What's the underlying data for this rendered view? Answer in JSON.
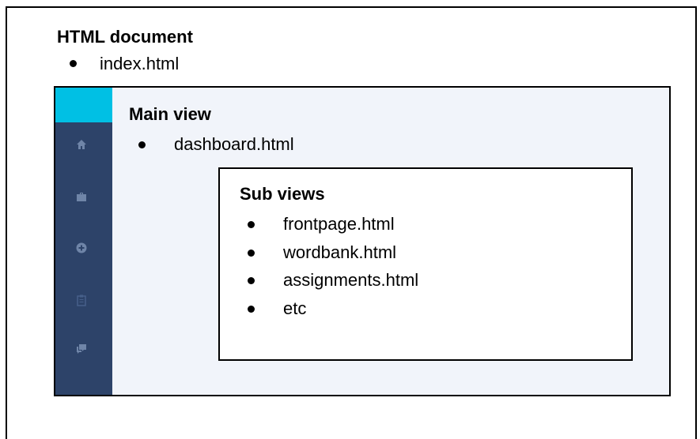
{
  "html_document": {
    "title": "HTML document",
    "files": [
      "index.html"
    ]
  },
  "main_view": {
    "title": "Main view",
    "files": [
      "dashboard.html"
    ]
  },
  "sub_views": {
    "title": "Sub views",
    "files": [
      "frontpage.html",
      "wordbank.html",
      "assignments.html",
      "etc"
    ]
  },
  "sidebar": {
    "icons": [
      "home-icon",
      "briefcase-icon",
      "add-circle-icon",
      "clipboard-icon",
      "chat-icon"
    ],
    "colors": {
      "background": "#2d4369",
      "accent": "#00c0e4",
      "icon": "#6f85a8"
    }
  }
}
